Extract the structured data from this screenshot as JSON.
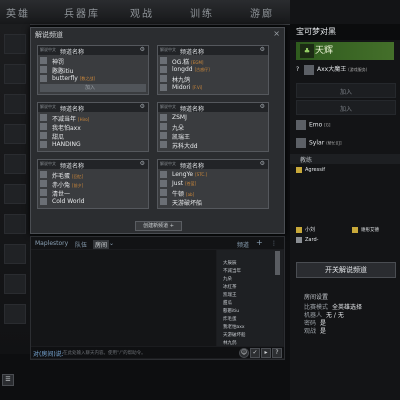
{
  "nav": [
    "英雄",
    "兵器库",
    "观战",
    "训练",
    "游廊"
  ],
  "panel": {
    "title": "解说频道",
    "close": "×",
    "channel_header": "频道名称",
    "pwd_header": "解说中文",
    "channels": [
      {
        "players": [
          {
            "name": "神罚",
            "tag": ""
          },
          {
            "name": "憨憨itiu",
            "tag": ""
          },
          {
            "name": "butterfly",
            "tag": "[数之战]"
          }
        ],
        "join": "加入"
      },
      {
        "players": [
          {
            "name": "OG.糕",
            "tag": "[EGM]"
          },
          {
            "name": "longdd",
            "tag": "[古惑仔]"
          },
          {
            "name": "林九鸽",
            "tag": ""
          },
          {
            "name": "Midori",
            "tag": "[F.Vi]"
          }
        ],
        "join": ""
      },
      {
        "players": [
          {
            "name": "不减当年",
            "tag": "[Hiro]"
          },
          {
            "name": "我老怕axx",
            "tag": ""
          },
          {
            "name": "甜瓜",
            "tag": ""
          },
          {
            "name": "HANDING",
            "tag": ""
          }
        ],
        "join": ""
      },
      {
        "players": [
          {
            "name": "ZSMJ",
            "tag": ""
          },
          {
            "name": "九朵",
            "tag": ""
          },
          {
            "name": "凯瑞王",
            "tag": ""
          },
          {
            "name": "苏科大dd",
            "tag": ""
          }
        ],
        "join": ""
      },
      {
        "players": [
          {
            "name": "炸毛蛋",
            "tag": "[回忆]"
          },
          {
            "name": "赤小兔",
            "tag": "[前夕]"
          },
          {
            "name": "清世一",
            "tag": ""
          },
          {
            "name": "Cold World",
            "tag": ""
          }
        ],
        "join": ""
      },
      {
        "players": [
          {
            "name": "LengYe",
            "tag": "[STC.]"
          },
          {
            "name": "Just",
            "tag": "[苍蓝]"
          },
          {
            "name": "牛顿",
            "tag": "[ab]"
          },
          {
            "name": "天游破坏船",
            "tag": ""
          }
        ],
        "join": ""
      }
    ],
    "create_label": "创建新频道 +"
  },
  "chat": {
    "tabs": [
      "Maplestory",
      "队伍",
      "房间"
    ],
    "tab_right": [
      "频道"
    ],
    "users": [
      "大辰辰",
      "不减当年",
      "九朵",
      "冰红茶",
      "凯瑞王",
      "甜瓜",
      "憨憨itiu",
      "炸毛蛋",
      "我老怕axx",
      "天游破坏船",
      "林九鸽"
    ],
    "input_label": "对(房间)说:",
    "input_placeholder": "在此处输入聊天内容。使用“/”的帮助令。"
  },
  "right": {
    "header": "宝可梦对黑",
    "team_name": "天辉",
    "leader_name": "Axx大魔王",
    "leader_tag": "(游戏服务)",
    "join_label": "加入",
    "p2": {
      "name": "Emo",
      "tag": "[G]"
    },
    "p3": {
      "name": "Sylar",
      "tag": "(帮忙)[J]"
    },
    "coach_label": "教练",
    "coach_name": "Agressif",
    "p4": "小刘",
    "p5": "谢彤艾德",
    "p6": "Zard-",
    "open_channel_btn": "开关解说频道",
    "settings_title": "房间设置",
    "settings": [
      {
        "k": "比赛模式",
        "v": "全英雄选择"
      },
      {
        "k": "机器人",
        "v": "无 / 无"
      },
      {
        "k": "密码",
        "v": "是"
      },
      {
        "k": "观战",
        "v": "是"
      }
    ]
  },
  "colors": {
    "accent_green": "#446f2a",
    "tag_orange": "#d08a3a"
  }
}
